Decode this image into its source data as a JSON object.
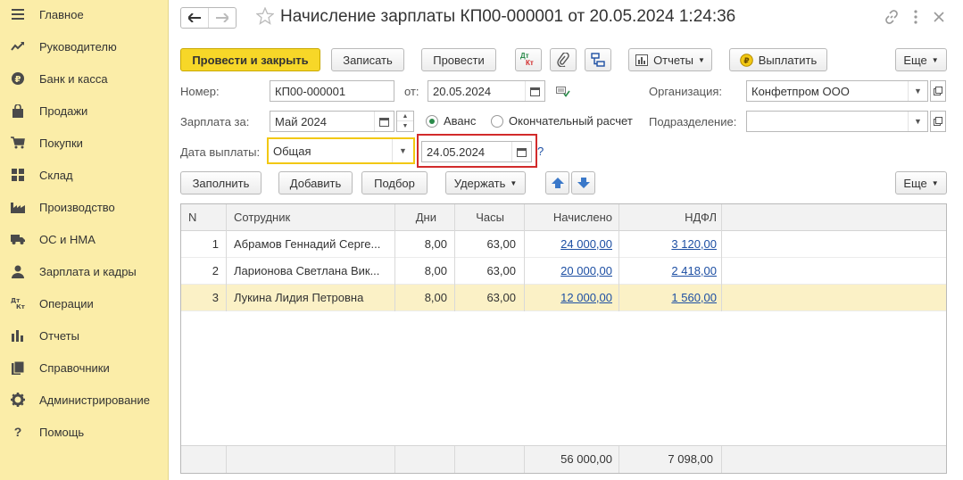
{
  "sidebar": {
    "items": [
      {
        "label": "Главное",
        "icon": "menu-icon"
      },
      {
        "label": "Руководителю",
        "icon": "trend-icon"
      },
      {
        "label": "Банк и касса",
        "icon": "ruble-icon"
      },
      {
        "label": "Продажи",
        "icon": "bag-icon"
      },
      {
        "label": "Покупки",
        "icon": "cart-icon"
      },
      {
        "label": "Склад",
        "icon": "warehouse-icon"
      },
      {
        "label": "Производство",
        "icon": "factory-icon"
      },
      {
        "label": "ОС и НМА",
        "icon": "truck-icon"
      },
      {
        "label": "Зарплата и кадры",
        "icon": "person-icon"
      },
      {
        "label": "Операции",
        "icon": "dt-kt-icon"
      },
      {
        "label": "Отчеты",
        "icon": "bar-chart-icon"
      },
      {
        "label": "Справочники",
        "icon": "books-icon"
      },
      {
        "label": "Администрирование",
        "icon": "gear-icon"
      },
      {
        "label": "Помощь",
        "icon": "question-icon"
      }
    ]
  },
  "header": {
    "title": "Начисление зарплаты КП00-000001 от 20.05.2024 1:24:36"
  },
  "toolbar": {
    "post_close": "Провести и закрыть",
    "save": "Записать",
    "post": "Провести",
    "dtkt_top": "Дт",
    "dtkt_bottom": "Кт",
    "reports": "Отчеты",
    "pay": "Выплатить",
    "more": "Еще"
  },
  "form": {
    "number_label": "Номер:",
    "number_value": "КП00-000001",
    "date_label": "от:",
    "date_value": "20.05.2024",
    "org_label": "Организация:",
    "org_value": "Конфетпром ООО",
    "salary_for_label": "Зарплата за:",
    "salary_for_value": "Май 2024",
    "advance_label": "Аванс",
    "final_label": "Окончательный расчет",
    "dept_label": "Подразделение:",
    "dept_value": "",
    "pay_date_label": "Дата выплаты:",
    "pay_date_type": "Общая",
    "pay_date_value": "24.05.2024",
    "help": "?"
  },
  "table_toolbar": {
    "fill": "Заполнить",
    "add": "Добавить",
    "select": "Подбор",
    "withhold": "Удержать",
    "more": "Еще"
  },
  "table": {
    "headers": {
      "n": "N",
      "employee": "Сотрудник",
      "days": "Дни",
      "hours": "Часы",
      "accrued": "Начислено",
      "ndfl": "НДФЛ"
    },
    "rows": [
      {
        "n": "1",
        "employee": "Абрамов Геннадий Серге...",
        "days": "8,00",
        "hours": "63,00",
        "accrued": "24 000,00",
        "ndfl": "3 120,00"
      },
      {
        "n": "2",
        "employee": "Ларионова Светлана Вик...",
        "days": "8,00",
        "hours": "63,00",
        "accrued": "20 000,00",
        "ndfl": "2 418,00"
      },
      {
        "n": "3",
        "employee": "Лукина Лидия Петровна",
        "days": "8,00",
        "hours": "63,00",
        "accrued": "12 000,00",
        "ndfl": "1 560,00"
      }
    ],
    "totals": {
      "accrued": "56 000,00",
      "ndfl": "7 098,00"
    }
  }
}
